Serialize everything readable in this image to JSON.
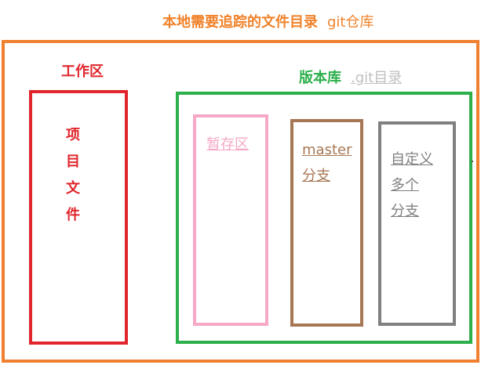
{
  "title": {
    "main": "本地需要追踪的文件目录",
    "sub": "git仓库"
  },
  "workspace": {
    "label": "工作区",
    "chars": [
      "项",
      "目",
      "文",
      "件"
    ]
  },
  "repository": {
    "label": "版本库",
    "sublabel": ".git目录",
    "staging": {
      "label": "暂存区"
    },
    "master": {
      "line1": "master",
      "line2": "分支"
    },
    "custom": {
      "line1": "自定义",
      "line2": "多个",
      "line3": "分支"
    }
  },
  "colors": {
    "outer": "#f08030",
    "workspace": "#e0262c",
    "repository": "#2db04c",
    "staging": "#f5a9c6",
    "master": "#a77755",
    "custom": "#808080"
  }
}
